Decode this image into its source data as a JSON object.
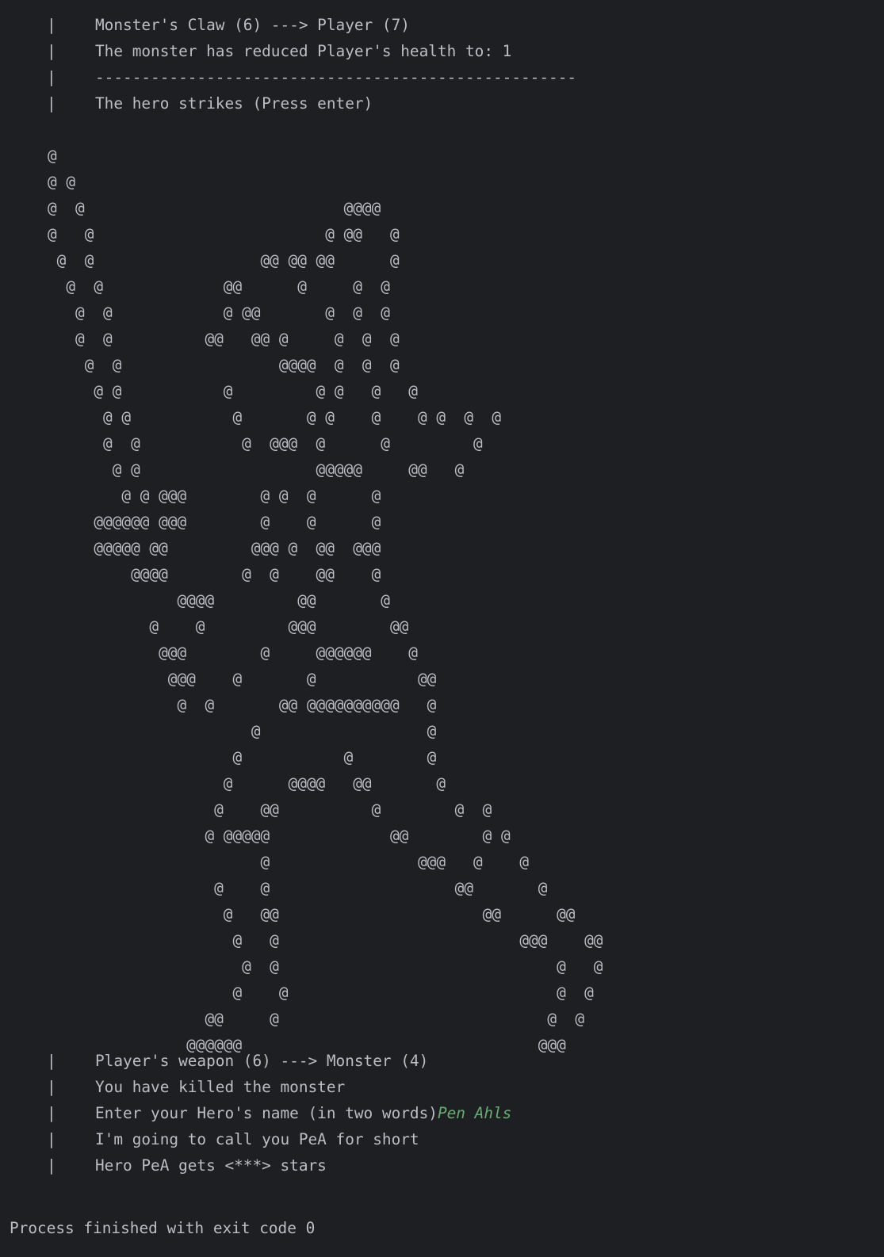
{
  "console": {
    "bar_glyph": "|",
    "top_lines": [
      "Monster's Claw (6) ---> Player (7)",
      "The monster has reduced Player's health to: 1",
      "----------------------------------------------------",
      "The hero strikes (Press enter)"
    ],
    "ascii_art": "@\n@ @\n@  @                            @@@@\n@   @                         @ @@   @\n @  @                  @@ @@ @@      @\n  @  @             @@      @     @  @\n   @  @            @ @@       @  @  @\n   @  @          @@   @@ @     @  @  @\n    @  @                 @@@@  @  @  @\n     @ @           @         @ @   @   @\n      @ @           @       @ @    @    @ @  @  @\n      @  @           @  @@@  @      @         @\n       @ @                   @@@@@     @@   @\n        @ @ @@@        @ @  @      @\n     @@@@@@ @@@        @    @      @\n     @@@@@ @@         @@@ @  @@  @@@\n         @@@@        @  @    @@    @\n              @@@@         @@       @\n           @    @         @@@        @@\n            @@@        @     @@@@@@    @\n             @@@    @       @           @@\n              @  @       @@ @@@@@@@@@@   @\n                      @                  @\n                    @           @        @\n                   @      @@@@   @@       @\n                  @    @@          @        @  @\n                 @ @@@@@             @@        @ @\n                       @                @@@   @    @\n                  @    @                    @@       @\n                   @   @@                      @@      @@\n                    @   @                          @@@    @@\n                     @  @                              @   @\n                    @    @                             @  @\n                 @@     @                             @  @\n               @@@@@@                                @@@",
    "bottom_lines": [
      "Player's weapon (6) ---> Monster (4)",
      "You have killed the monster",
      "Enter your Hero's name (in two words)",
      "I'm going to call you PeA for short",
      "Hero PeA gets <***> stars"
    ],
    "user_input": "Pen Ahls",
    "exit_message": "Process finished with exit code 0"
  }
}
